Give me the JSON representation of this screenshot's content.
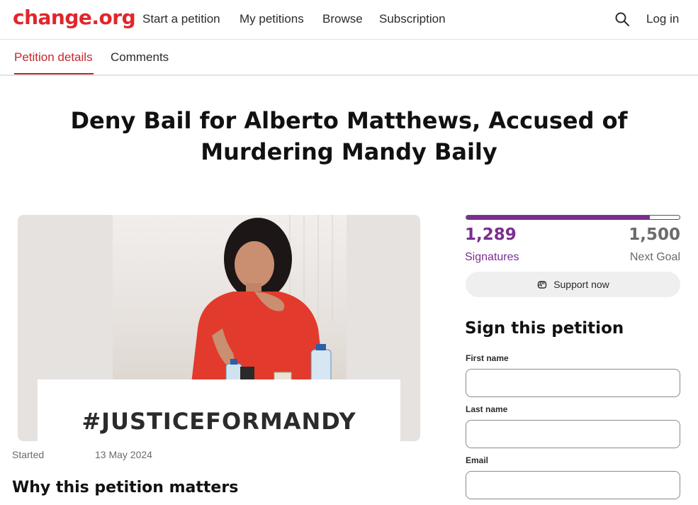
{
  "header": {
    "logo": "change.org",
    "nav": [
      "Start a petition",
      "My petitions",
      "Browse",
      "Subscription"
    ],
    "login": "Log in"
  },
  "tabs": {
    "active": "Petition details",
    "comments": "Comments"
  },
  "petition": {
    "title": "Deny Bail for Alberto Matthews, Accused of Murdering Mandy Baily",
    "image_caption": "#JUSTICEFORMANDY",
    "started_label": "Started",
    "started_date": "13 May 2024",
    "why_heading": "Why this petition matters"
  },
  "stats": {
    "signatures": "1,289",
    "signatures_label": "Signatures",
    "goal": "1,500",
    "goal_label": "Next Goal",
    "progress_fraction": 0.859
  },
  "support": {
    "label": "Support now",
    "icon": "fist-icon"
  },
  "sign_form": {
    "heading": "Sign this petition",
    "first_name_label": "First name",
    "last_name_label": "Last name",
    "email_label": "Email"
  },
  "colors": {
    "brand_red": "#e0262b",
    "tab_active": "#c5272c",
    "progress_purple": "#7a2e8f"
  }
}
